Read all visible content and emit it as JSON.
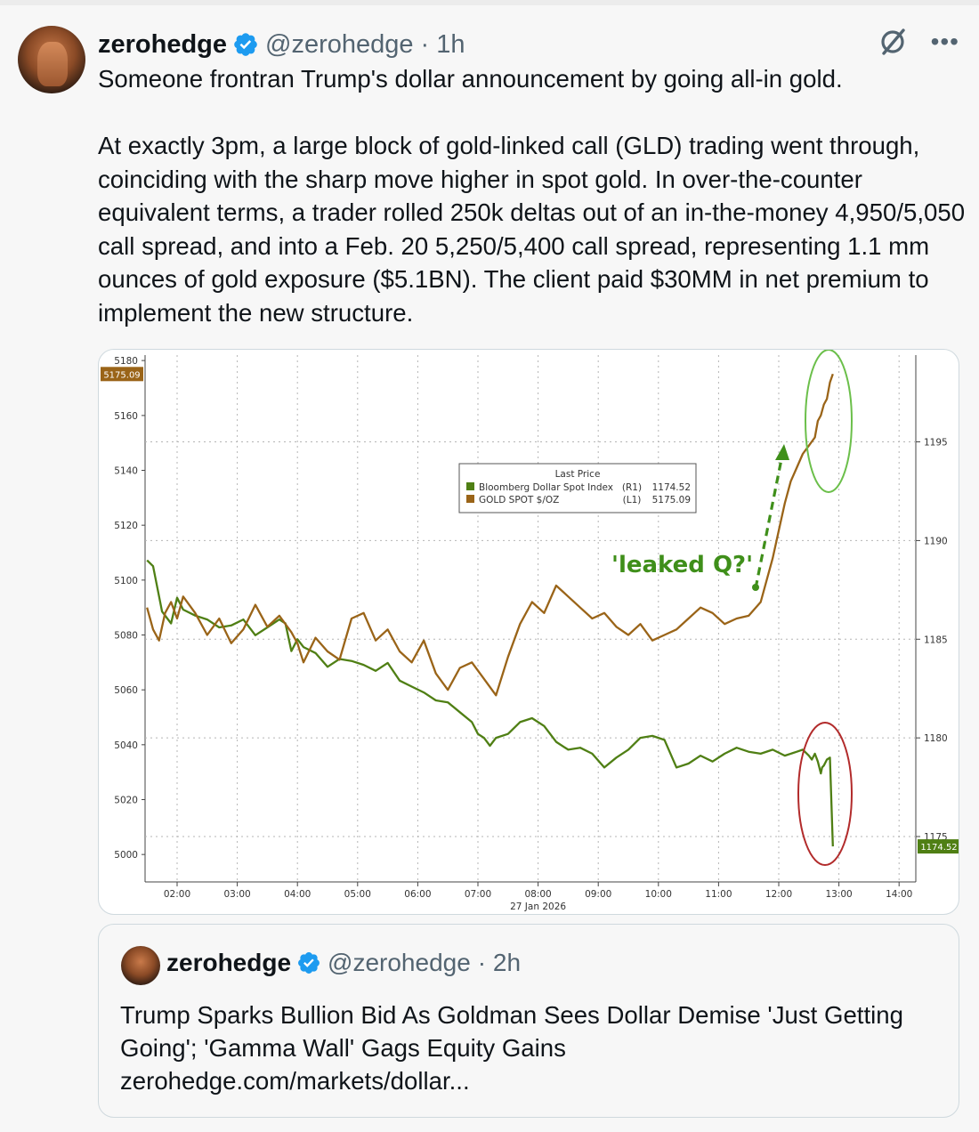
{
  "tweet": {
    "author_name": "zerohedge",
    "handle": "@zerohedge",
    "time": "· 1h",
    "text_line1": "Someone frontran Trump's dollar announcement by going all-in gold.",
    "text_para2": "At exactly 3pm, a large block of gold-linked call (GLD) trading went through, coinciding with the sharp move higher in spot gold.  In over-the-counter equivalent terms, a trader rolled 250k deltas out of an in-the-money 4,950/5,050 call spread, and into a Feb. 20 5,250/5,400 call spread, representing 1.1 mm ounces of gold exposure ($5.1BN). The client paid $30MM in net premium to implement the new structure."
  },
  "chart_data": {
    "type": "line",
    "date_label": "27 Jan 2026",
    "x_ticks": [
      "02:00",
      "03:00",
      "04:00",
      "05:00",
      "06:00",
      "07:00",
      "08:00",
      "09:00",
      "10:00",
      "11:00",
      "12:00",
      "13:00",
      "14:00"
    ],
    "left_axis": {
      "ticks": [
        5000,
        5020,
        5040,
        5060,
        5080,
        5100,
        5120,
        5140,
        5160,
        5180
      ],
      "ylim": [
        4990,
        5182
      ]
    },
    "right_axis": {
      "ticks": [
        1175,
        1180,
        1185,
        1190,
        1195
      ],
      "ylim": [
        1172.7,
        1199.4
      ]
    },
    "legend": {
      "title": "Last Price",
      "entries": [
        {
          "name": "Bloomberg Dollar Spot Index",
          "axis": "(R1)",
          "value": "1174.52"
        },
        {
          "name": "GOLD SPOT $/OZ",
          "axis": "(L1)",
          "value": "5175.09"
        }
      ],
      "placement": "center"
    },
    "last_labels": {
      "left": "5175.09",
      "right": "1174.52"
    },
    "annotation": "'leaked Q?'",
    "grid": true,
    "series": [
      {
        "name": "Bloomberg Dollar Spot Index",
        "axis": "right",
        "color": "#4f7f14",
        "x": [
          1.5,
          1.6,
          1.75,
          1.9,
          2.0,
          2.1,
          2.3,
          2.5,
          2.7,
          2.9,
          3.1,
          3.3,
          3.5,
          3.7,
          3.8,
          3.9,
          4.0,
          4.1,
          4.3,
          4.5,
          4.7,
          4.9,
          5.1,
          5.3,
          5.5,
          5.7,
          5.9,
          6.1,
          6.3,
          6.5,
          6.7,
          6.9,
          7.0,
          7.1,
          7.2,
          7.3,
          7.5,
          7.7,
          7.9,
          8.1,
          8.3,
          8.5,
          8.7,
          8.9,
          9.1,
          9.3,
          9.5,
          9.7,
          9.9,
          10.1,
          10.3,
          10.5,
          10.7,
          10.9,
          11.1,
          11.3,
          11.5,
          11.7,
          11.9,
          12.1,
          12.3,
          12.4,
          12.5,
          12.55,
          12.6,
          12.65,
          12.7,
          12.72,
          12.75,
          12.8,
          12.85,
          12.9
        ],
        "y": [
          1189.0,
          1188.7,
          1186.4,
          1185.8,
          1187.1,
          1186.5,
          1186.2,
          1186.0,
          1185.6,
          1185.7,
          1186.0,
          1185.2,
          1185.6,
          1186.0,
          1185.8,
          1184.4,
          1185.0,
          1184.6,
          1184.3,
          1183.6,
          1184.0,
          1183.9,
          1183.7,
          1183.4,
          1183.8,
          1182.9,
          1182.6,
          1182.3,
          1181.9,
          1181.8,
          1181.3,
          1180.8,
          1180.2,
          1180.0,
          1179.6,
          1180.0,
          1180.2,
          1180.8,
          1181.0,
          1180.6,
          1179.8,
          1179.4,
          1179.5,
          1179.2,
          1178.5,
          1179.0,
          1179.4,
          1180.0,
          1180.1,
          1179.9,
          1178.5,
          1178.7,
          1179.1,
          1178.8,
          1179.2,
          1179.5,
          1179.3,
          1179.2,
          1179.4,
          1179.1,
          1179.3,
          1179.4,
          1179.1,
          1178.9,
          1179.2,
          1178.8,
          1178.2,
          1178.5,
          1178.6,
          1178.9,
          1179.0,
          1174.5
        ]
      },
      {
        "name": "GOLD SPOT $/OZ",
        "axis": "left",
        "color": "#9a6418",
        "x": [
          1.5,
          1.6,
          1.7,
          1.8,
          1.9,
          2.0,
          2.1,
          2.3,
          2.5,
          2.7,
          2.9,
          3.1,
          3.3,
          3.5,
          3.7,
          3.9,
          4.0,
          4.1,
          4.3,
          4.5,
          4.7,
          4.9,
          5.1,
          5.3,
          5.5,
          5.7,
          5.9,
          6.1,
          6.3,
          6.5,
          6.7,
          6.9,
          7.1,
          7.3,
          7.5,
          7.7,
          7.9,
          8.1,
          8.3,
          8.5,
          8.7,
          8.9,
          9.1,
          9.3,
          9.5,
          9.7,
          9.9,
          10.1,
          10.3,
          10.5,
          10.7,
          10.9,
          11.1,
          11.3,
          11.5,
          11.7,
          11.9,
          12.0,
          12.1,
          12.2,
          12.3,
          12.4,
          12.5,
          12.6,
          12.65,
          12.7,
          12.75,
          12.8,
          12.85,
          12.9
        ],
        "y": [
          5090.0,
          5082.0,
          5078.0,
          5088.0,
          5092.0,
          5086.0,
          5094.0,
          5088.0,
          5080.0,
          5086.0,
          5077.0,
          5082.0,
          5091.0,
          5083.0,
          5087.0,
          5081.0,
          5077.0,
          5070.0,
          5079.0,
          5074.0,
          5071.0,
          5086.0,
          5088.0,
          5078.0,
          5082.0,
          5074.0,
          5070.0,
          5078.0,
          5066.0,
          5060.0,
          5068.0,
          5070.0,
          5064.0,
          5058.0,
          5072.0,
          5084.0,
          5092.0,
          5088.0,
          5098.0,
          5094.0,
          5090.0,
          5086.0,
          5088.0,
          5083.0,
          5080.0,
          5084.0,
          5078.0,
          5080.0,
          5082.0,
          5086.0,
          5090.0,
          5088.0,
          5084.0,
          5086.0,
          5087.0,
          5092.0,
          5108.0,
          5118.0,
          5128.0,
          5136.0,
          5141.0,
          5146.0,
          5149.0,
          5152.0,
          5158.0,
          5160.0,
          5164.0,
          5166.0,
          5172.0,
          5175.09
        ]
      }
    ]
  },
  "quote": {
    "author_name": "zerohedge",
    "handle": "@zerohedge",
    "time": "· 2h",
    "line1": "Trump Sparks Bullion Bid As Goldman Sees Dollar Demise 'Just Getting",
    "line2": "Going'; 'Gamma Wall' Gags Equity Gains",
    "link": "zerohedge.com/markets/dollar..."
  },
  "colors": {
    "verified": "#1d9bf0",
    "dollar_series": "#4f7f14",
    "gold_series": "#9a6418",
    "arrow": "#3f8f1a",
    "gold_circle": "#6bbf4a",
    "dollar_circle": "#b22b2b"
  },
  "icons": [
    "verified-badge-icon",
    "grok-icon",
    "more-icon"
  ]
}
